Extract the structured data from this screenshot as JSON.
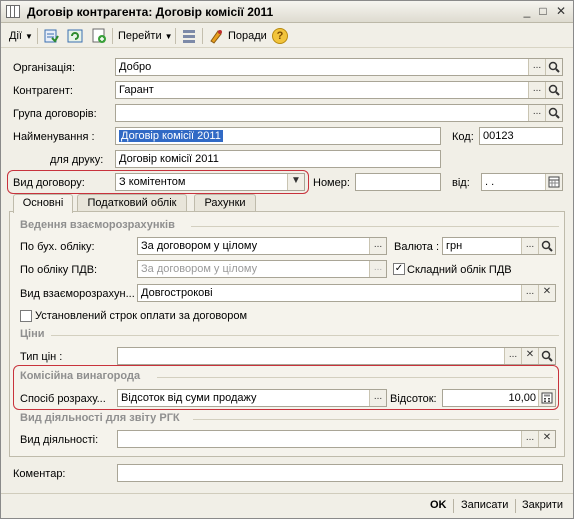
{
  "window": {
    "title": "Договір контрагента: Договір комісії 2011",
    "minimize": "_",
    "maximize": "□",
    "close": "✕"
  },
  "toolbar": {
    "actions_label": "Дії",
    "goto_label": "Перейти",
    "hints_label": "Поради",
    "help_label": "?"
  },
  "fields": {
    "organization": {
      "label": "Організація:",
      "value": "Добро"
    },
    "counterparty": {
      "label": "Контрагент:",
      "value": "Гарант"
    },
    "contract_group": {
      "label": "Група договорів:",
      "value": ""
    },
    "name": {
      "label": "Найменування :",
      "value": "Договір комісії 2011"
    },
    "code": {
      "label": "Код:",
      "value": "00123"
    },
    "print_name": {
      "label": "для друку:",
      "value": "Договір комісії 2011"
    },
    "contract_type": {
      "label": "Вид договору:",
      "value": "З комітентом"
    },
    "number": {
      "label": "Номер:",
      "value": ""
    },
    "date": {
      "label": "від:",
      "value": ". ."
    }
  },
  "tabs": [
    {
      "label": "Основні",
      "active": true
    },
    {
      "label": "Податковий облік",
      "active": false
    },
    {
      "label": "Рахунки",
      "active": false
    }
  ],
  "settlements": {
    "section_title": "Ведення взаєморозрахунків",
    "by_accounting_label": "По бух. обліку:",
    "by_accounting_value": "За договором у цілому",
    "currency_label": "Валюта :",
    "currency_value": "грн",
    "by_vat_label": "По обліку ПДВ:",
    "by_vat_value": "За договором у цілому",
    "complex_vat_label": "Складний облік ПДВ",
    "complex_vat_checked": true,
    "kind_label": "Вид взаєморозрахун...",
    "kind_value": "Довгострокові",
    "payment_term_label": "Установлений строк оплати за договором",
    "payment_term_checked": false
  },
  "prices": {
    "section_title": "Ціни",
    "price_type_label": "Тип цін :",
    "price_type_value": ""
  },
  "commission": {
    "section_title": "Комісійна винагорода",
    "method_label": "Спосіб розраху...",
    "method_value": "Відсоток від суми продажу",
    "percent_label": "Відсоток:",
    "percent_value": "10,00"
  },
  "activity": {
    "section_title": "Вид діяльності для звіту РГК",
    "kind_label": "Вид діяльності:",
    "kind_value": ""
  },
  "comment": {
    "label": "Коментар:",
    "value": ""
  },
  "buttons": {
    "ok": "OK",
    "save": "Записати",
    "close": "Закрити"
  },
  "icons": {
    "select": "...",
    "search": "magnifier",
    "clear": "✕",
    "dropdown": "▼",
    "calendar": "calendar",
    "calculator": "calculator"
  }
}
